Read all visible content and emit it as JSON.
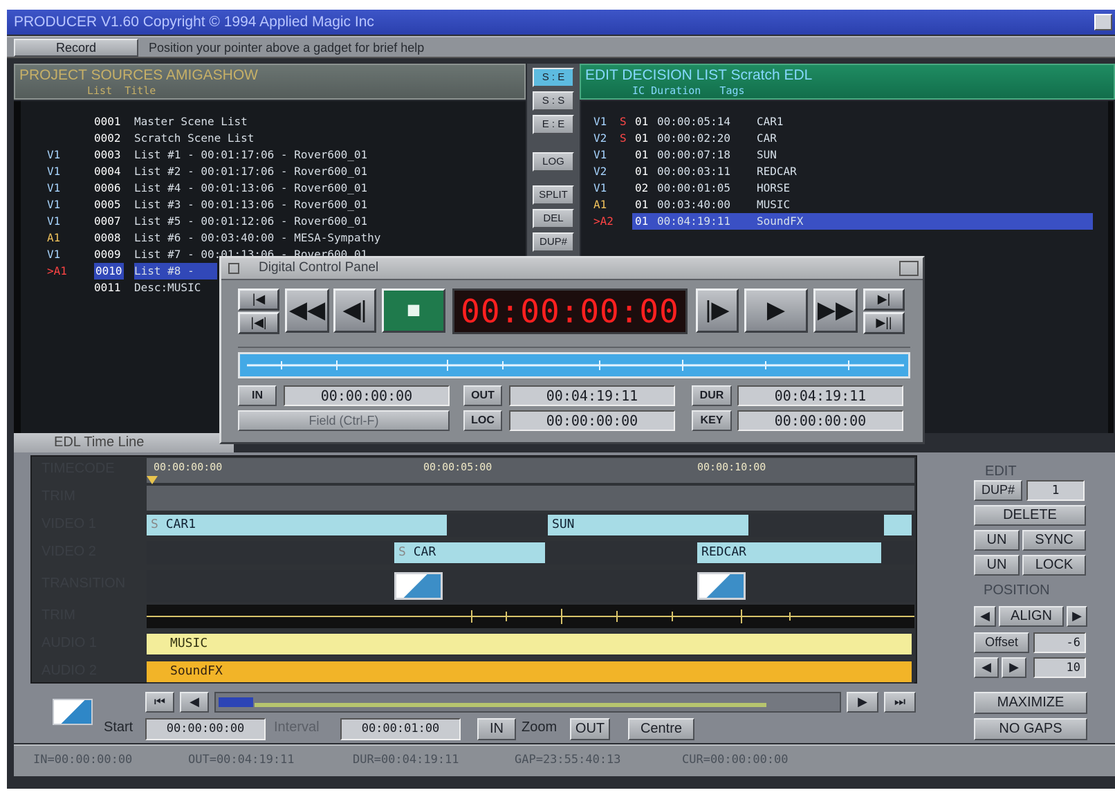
{
  "window": {
    "title": "PRODUCER V1.60 Copyright © 1994 Applied Magic Inc"
  },
  "helpbar": {
    "record_label": "Record",
    "help_text": "Position your pointer above a gadget for brief help"
  },
  "sources": {
    "header": "PROJECT SOURCES   AMIGASHOW",
    "columns": "List  Title",
    "rows": [
      {
        "tag": "",
        "num": "0001",
        "title": "Master Scene List"
      },
      {
        "tag": "",
        "num": "0002",
        "title": "Scratch Scene List"
      },
      {
        "tag": "V1",
        "num": "0003",
        "title": "List #1 - 00:01:17:06 - Rover600_01"
      },
      {
        "tag": "V1",
        "num": "0004",
        "title": "List #2 - 00:01:17:06 - Rover600_01"
      },
      {
        "tag": "V1",
        "num": "0006",
        "title": "List #4 - 00:01:13:06 - Rover600_01"
      },
      {
        "tag": "V1",
        "num": "0005",
        "title": "List #3 - 00:01:13:06 - Rover600_01"
      },
      {
        "tag": "V1",
        "num": "0007",
        "title": "List #5 - 00:01:12:06 - Rover600_01"
      },
      {
        "tag": "A1",
        "num": "0008",
        "title": "List #6 - 00:03:40:00 - MESA-Sympathy"
      },
      {
        "tag": "V1",
        "num": "0009",
        "title": "List #7 - 00:01:13:06 - Rover600_01"
      },
      {
        "tag": ">A1",
        "num": "0010",
        "title": "List #8 -"
      },
      {
        "tag": "",
        "num": "0011",
        "title": "Desc:MUSIC"
      }
    ]
  },
  "mid_buttons": {
    "se": "S : E",
    "ss": "S : S",
    "ee": "E : E",
    "log": "LOG",
    "split": "SPLIT",
    "del": "DEL",
    "dup": "DUP#"
  },
  "edl": {
    "header": "EDIT DECISION LIST   Scratch EDL",
    "columns": "IC Duration   Tags",
    "rows": [
      {
        "track": "V1",
        "s": "S",
        "ic": "01",
        "duration": "00:00:05:14",
        "tag": "CAR1"
      },
      {
        "track": "V2",
        "s": "S",
        "ic": "01",
        "duration": "00:00:02:20",
        "tag": "CAR"
      },
      {
        "track": "V1",
        "s": "",
        "ic": "01",
        "duration": "00:00:07:18",
        "tag": "SUN"
      },
      {
        "track": "V2",
        "s": "",
        "ic": "01",
        "duration": "00:00:03:11",
        "tag": "REDCAR"
      },
      {
        "track": "V1",
        "s": "",
        "ic": "02",
        "duration": "00:00:01:05",
        "tag": "HORSE"
      },
      {
        "track": "A1",
        "s": "",
        "ic": "01",
        "duration": "00:03:40:00",
        "tag": "MUSIC"
      },
      {
        "track": ">A2",
        "s": "",
        "ic": "01",
        "duration": "00:04:19:11",
        "tag": "SoundFX"
      }
    ]
  },
  "dcp": {
    "title": "Digital Control Panel",
    "timecode": "00:00:00:00",
    "in_label": "IN",
    "in_value": "00:00:00:00",
    "out_label": "OUT",
    "out_value": "00:04:19:11",
    "dur_label": "DUR",
    "dur_value": "00:04:19:11",
    "loc_label": "LOC",
    "loc_value": "00:00:00:00",
    "key_label": "KEY",
    "key_value": "00:00:00:00",
    "field_label": "Field (Ctrl-F)"
  },
  "timeline": {
    "title": "EDL Time Line",
    "ruler": [
      "00:00:00:00",
      "00:00:05:00",
      "00:00:10:00"
    ],
    "tracks": {
      "timecode": "TIMECODE",
      "trim1": "TRIM",
      "video1": "VIDEO 1",
      "video2": "VIDEO 2",
      "transition": "TRANSITION",
      "trim2": "TRIM",
      "audio1": "AUDIO 1",
      "audio2": "AUDIO 2"
    },
    "clips": {
      "car1": "CAR1",
      "sun": "SUN",
      "car": "CAR",
      "redcar": "REDCAR",
      "music": "MUSIC",
      "soundfx": "SoundFX",
      "s": "S"
    },
    "start_label": "Start",
    "start_value": "00:00:00:00",
    "interval_label": "Interval",
    "interval_value": "00:00:01:00",
    "in_btn": "IN",
    "zoom_label": "Zoom",
    "out_btn": "OUT",
    "centre_btn": "Centre",
    "edit_label": "EDIT",
    "dup_btn": "DUP#",
    "dup_value": "1",
    "delete_btn": "DELETE",
    "un1": "UN",
    "sync": "SYNC",
    "un2": "UN",
    "lock": "LOCK",
    "position_label": "POSITION",
    "align_btn": "ALIGN",
    "offset_label": "Offset",
    "offset_value": "-6",
    "step_value": "10",
    "maximize_btn": "MAXIMIZE",
    "nogaps_btn": "NO GAPS"
  },
  "status": {
    "in": "IN=00:00:00:00",
    "out": "OUT=00:04:19:11",
    "dur": "DUR=00:04:19:11",
    "gap": "GAP=23:55:40:13",
    "cur": "CUR=00:00:00:00"
  },
  "colors": {
    "title_bar": "#2b40ad",
    "edl_header": "#126e4b",
    "timecode": "#ff2020",
    "video_clip": "#a7dce6",
    "audio1_clip": "#f3ed9a",
    "audio2_clip": "#f2b428"
  }
}
